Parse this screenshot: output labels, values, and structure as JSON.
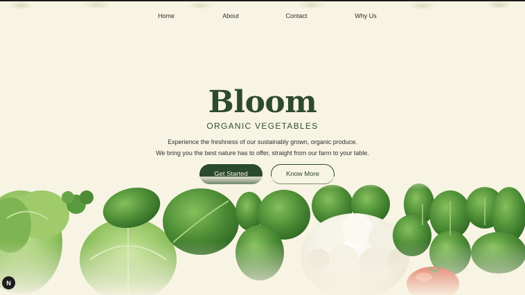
{
  "nav": {
    "items": [
      {
        "label": "Home"
      },
      {
        "label": "About"
      },
      {
        "label": "Contact"
      },
      {
        "label": "Why Us"
      }
    ]
  },
  "hero": {
    "brand": "Bloom",
    "tagline": "ORGANIC VEGETABLES",
    "description_line1": "Experience the freshness of our sustainably grown, organic produce.",
    "description_line2": "We bring you the best nature has to offer, straight from our farm to your table.",
    "primary_button": "Get Started",
    "secondary_button": "Know More"
  },
  "floating_badge": {
    "label": "N"
  },
  "colors": {
    "background": "#f8f4e3",
    "brand_green": "#2e4a2c",
    "button_green": "#2b4a2d",
    "leaf_green": "#5e9a45",
    "cauliflower": "#f2efe4",
    "tomato": "#d8432e"
  },
  "decor": {
    "illustration": "vegetables-illustration",
    "icons": [
      "leaf-icon",
      "cauliflower-icon",
      "tomato-icon"
    ]
  }
}
